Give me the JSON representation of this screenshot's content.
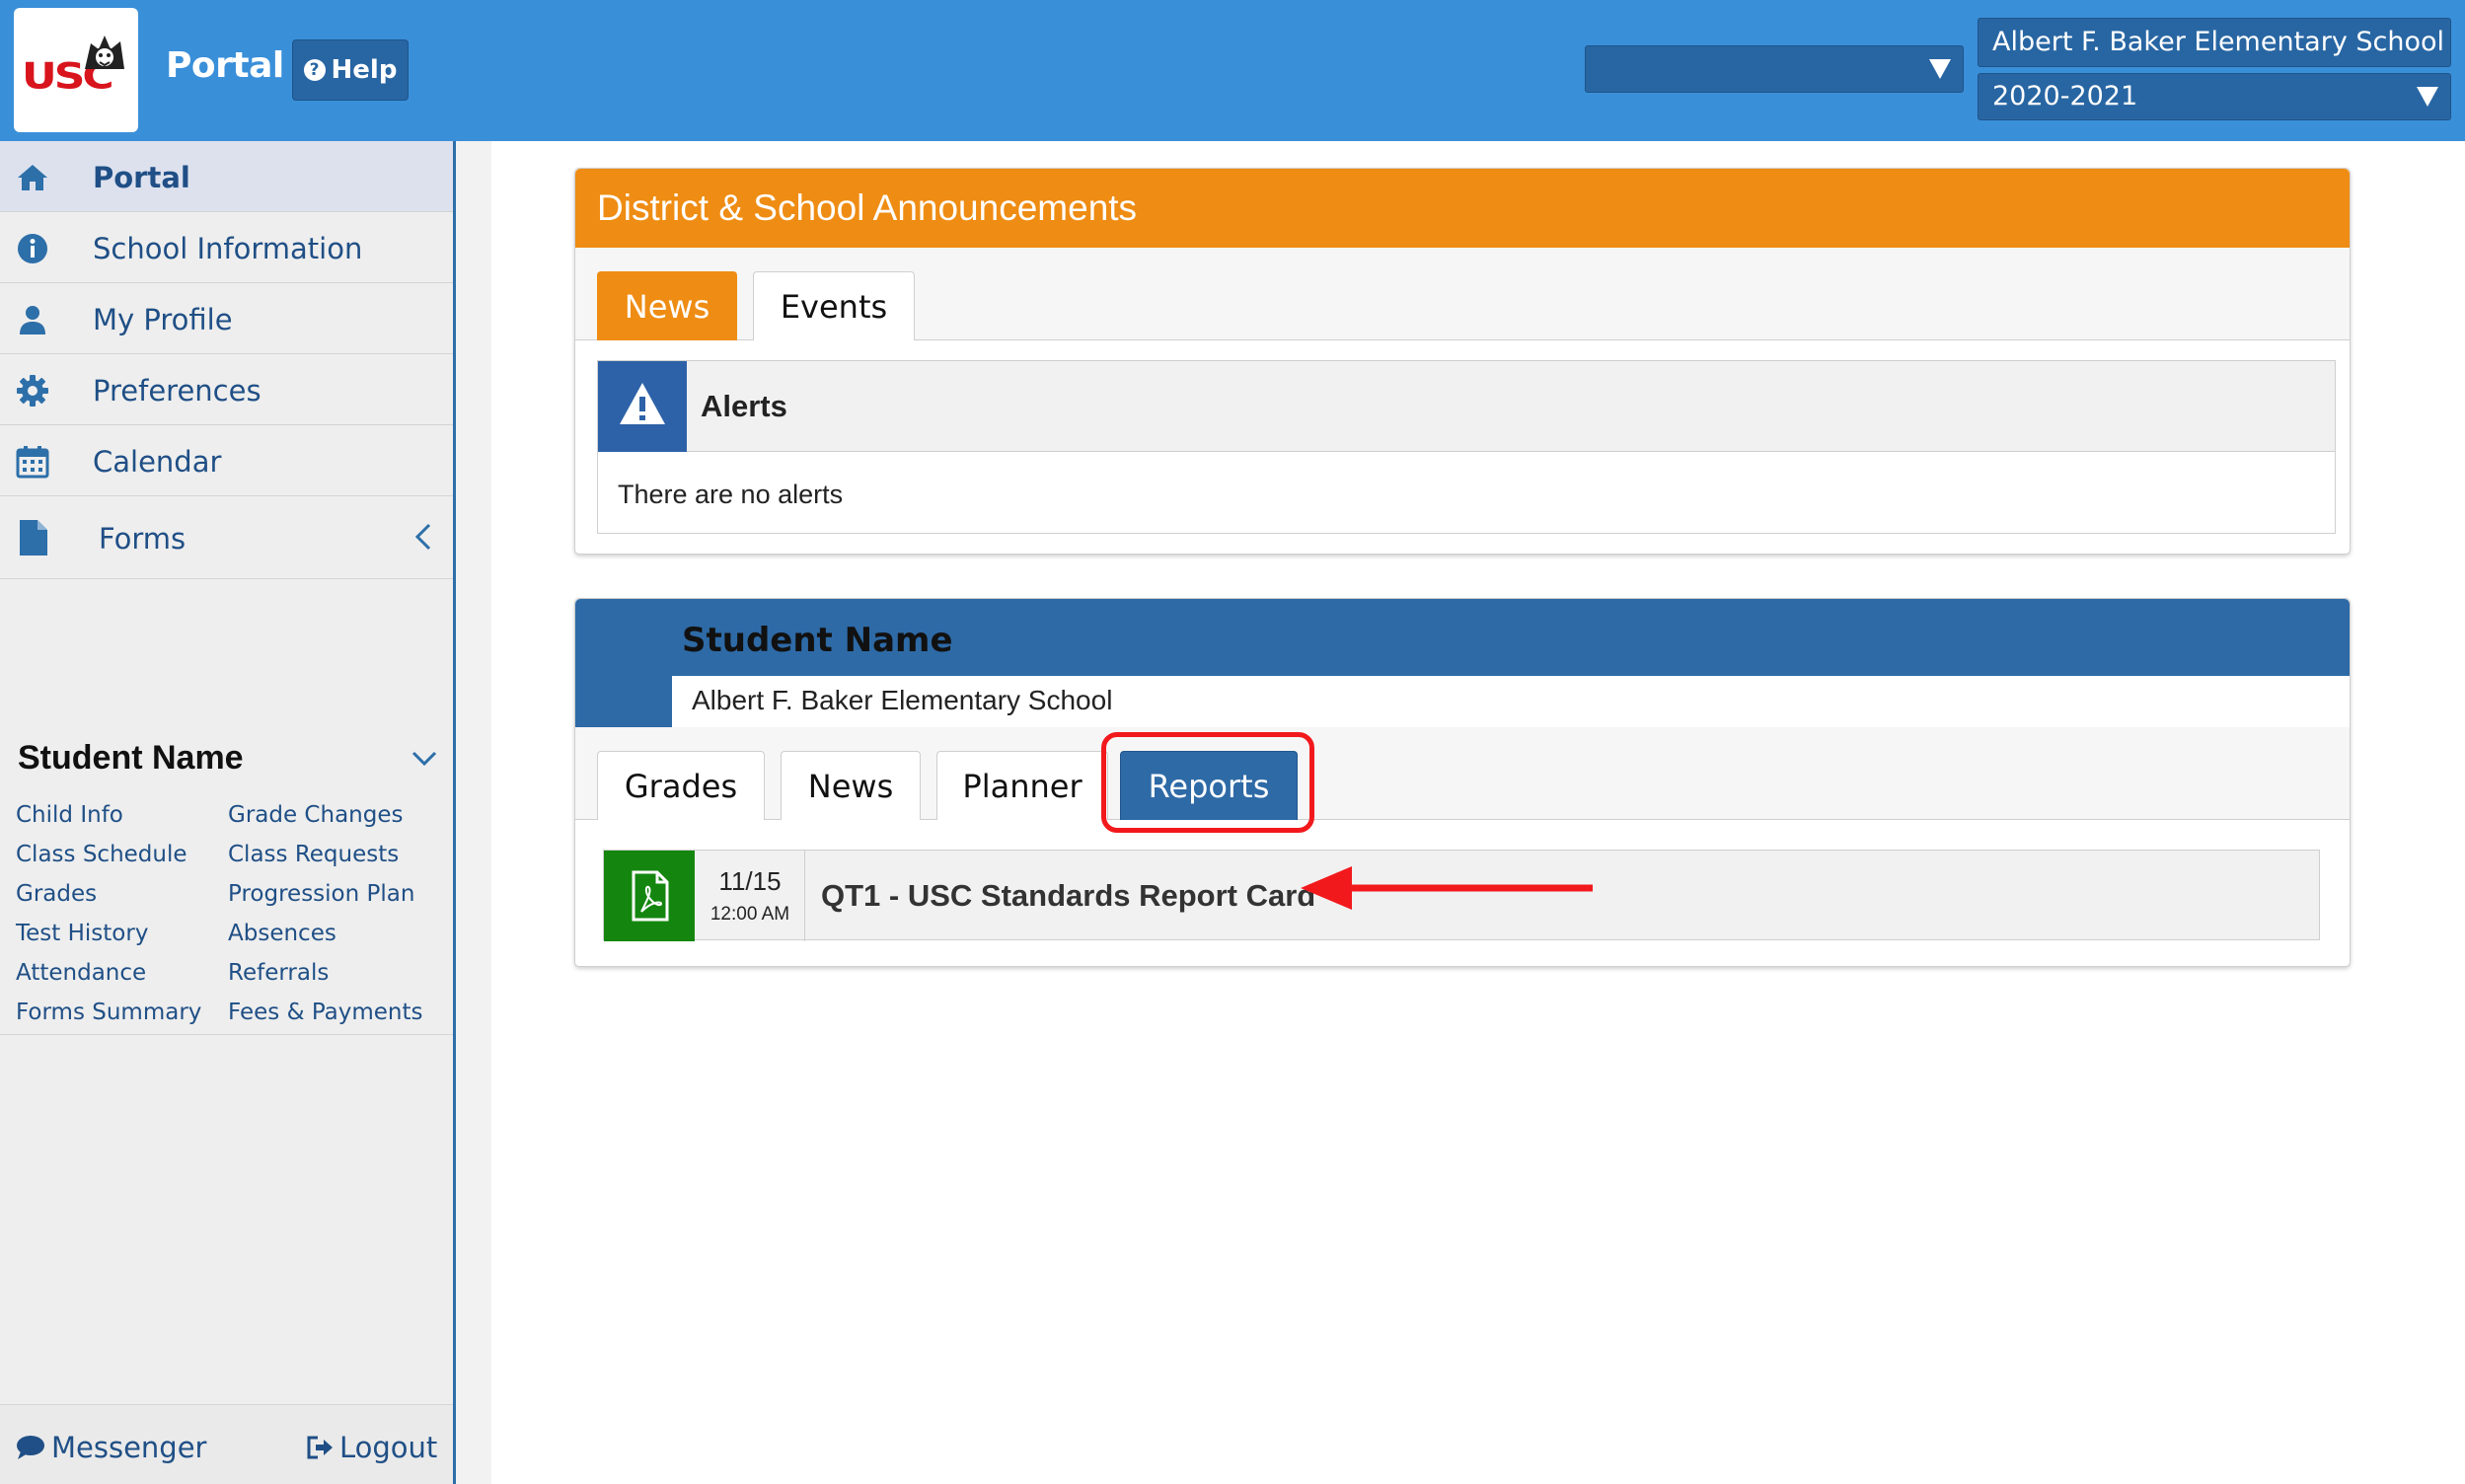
{
  "header": {
    "logo_text": "USC",
    "portal_title": "Portal",
    "help_label": "Help",
    "district_select_value": "",
    "school_select_value": "Albert F. Baker Elementary School",
    "year_select_value": "2020-2021"
  },
  "sidebar": {
    "nav": [
      {
        "label": "Portal",
        "icon": "home-icon",
        "active": true
      },
      {
        "label": "School Information",
        "icon": "info-icon"
      },
      {
        "label": "My Profile",
        "icon": "user-icon"
      },
      {
        "label": "Preferences",
        "icon": "gear-icon"
      },
      {
        "label": "Calendar",
        "icon": "calendar-icon"
      },
      {
        "label": "Forms",
        "icon": "document-icon"
      }
    ],
    "student": {
      "name": "Student Name",
      "links_left": [
        "Child Info",
        "Class Schedule",
        "Grades",
        "Test History",
        "Attendance",
        "Forms Summary"
      ],
      "links_right": [
        "Grade Changes",
        "Class Requests",
        "Progression Plan",
        "Absences",
        "Referrals",
        "Fees & Payments"
      ]
    },
    "footer": {
      "messenger_label": "Messenger",
      "logout_label": "Logout"
    }
  },
  "announcements": {
    "title": "District & School Announcements",
    "tabs": [
      "News",
      "Events"
    ],
    "active_tab": "News",
    "alerts_title": "Alerts",
    "alerts_message": "There are no alerts"
  },
  "student_panel": {
    "name": "Student Name",
    "school": "Albert F. Baker Elementary School",
    "tabs": [
      "Grades",
      "News",
      "Planner",
      "Reports"
    ],
    "active_tab": "Reports",
    "reports": [
      {
        "date": "11/15",
        "time": "12:00 AM",
        "title": "QT1 - USC Standards Report Card"
      }
    ]
  },
  "colors": {
    "header_blue": "#3a8fd9",
    "dark_blue": "#2e6aa6",
    "orange": "#ef8c13",
    "pdf_green": "#14860f",
    "annotation_red": "#f2191d"
  }
}
